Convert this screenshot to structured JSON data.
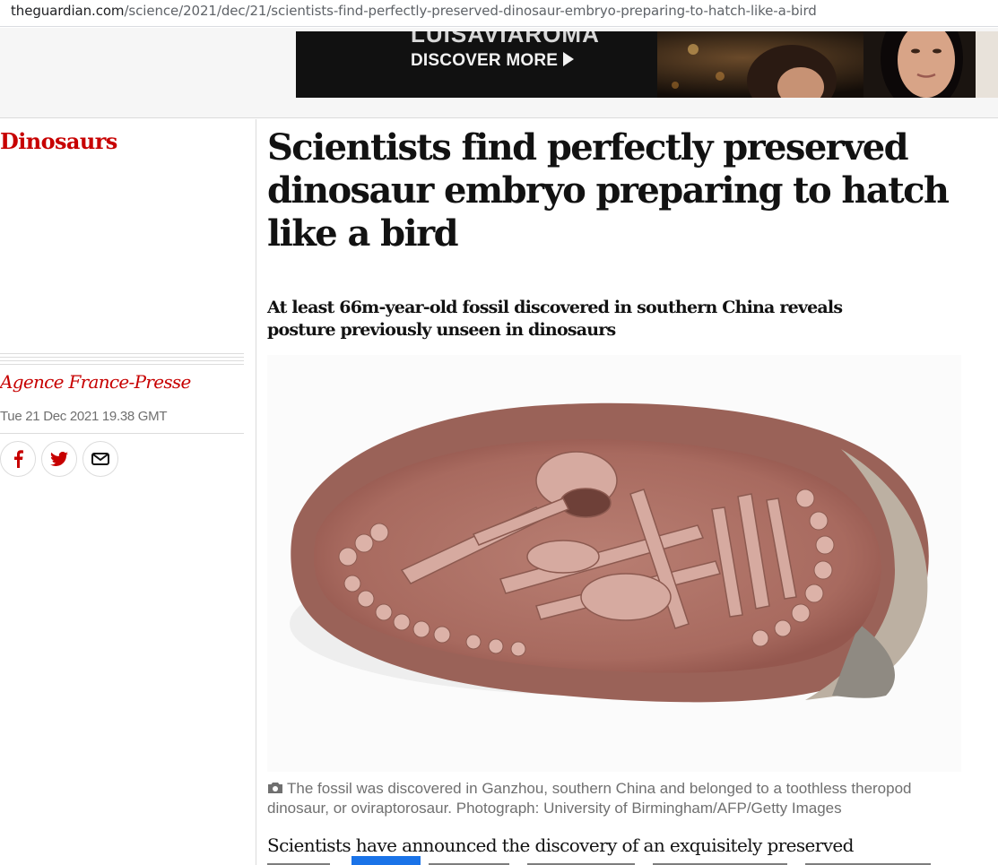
{
  "browser": {
    "url_domain": "theguardian.com",
    "url_path": "/science/2021/dec/21/scientists-find-perfectly-preserved-dinosaur-embryo-preparing-to-hatch-like-a-bird"
  },
  "ad": {
    "brand_text": "LUISAVIAROMA",
    "cta_label": "DISCOVER MORE"
  },
  "article": {
    "section": "Dinosaurs",
    "byline": "Agence France-Presse",
    "date": "Tue 21 Dec 2021 19.38 GMT",
    "headline": "Scientists find perfectly preserved dinosaur embryo preparing to hatch like a bird",
    "standfirst": "At least 66m-year-old fossil discovered in southern China reveals posture previously unseen in dinosaurs",
    "image_caption": "The fossil was discovered in Ganzhou, southern China and belonged to a toothless theropod dinosaur, or oviraptorosaur. Photograph: University of Birmingham/AFP/Getty Images",
    "body_first_line": "Scientists have announced the discovery of an exquisitely preserved"
  },
  "share_icons": [
    "facebook-icon",
    "twitter-icon",
    "email-icon"
  ],
  "colors": {
    "accent_red": "#c70000",
    "meta_grey": "#707070",
    "selection_blue": "#1a73e8"
  }
}
